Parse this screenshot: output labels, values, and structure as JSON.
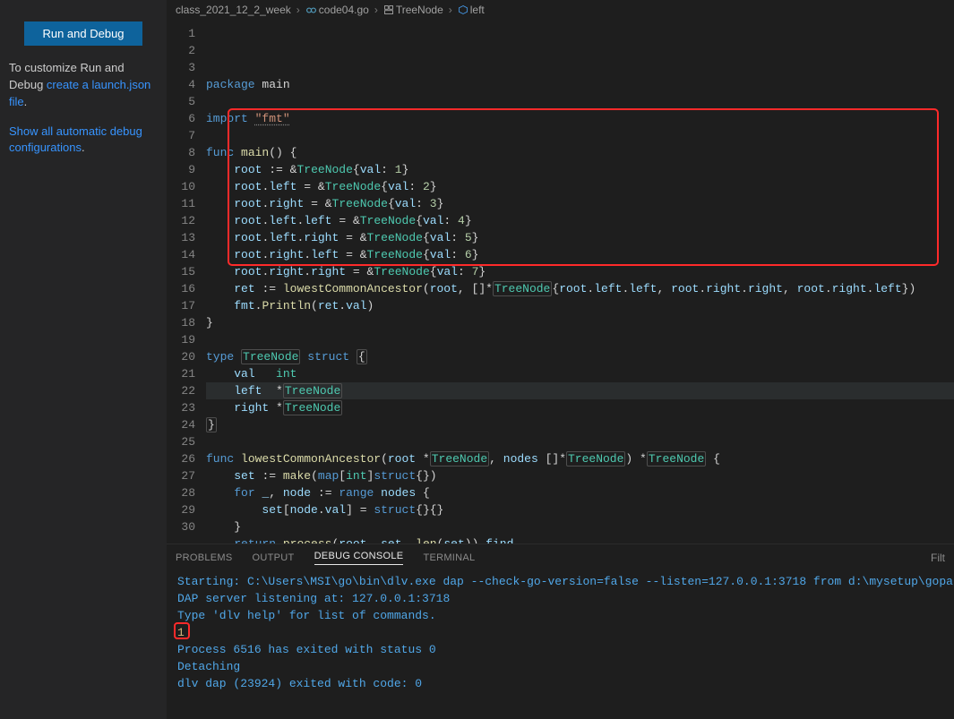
{
  "sidebar": {
    "run_debug_label": "Run and Debug",
    "customize_prefix": "To customize Run and Debug ",
    "customize_link1": "create a launch.json file",
    "customize_suffix": ".",
    "link2_prefix": "Show all automatic debug configurations",
    "link2_suffix": "."
  },
  "breadcrumbs": {
    "seg0": "class_2021_12_2_week",
    "seg1": "code04.go",
    "seg2": "TreeNode",
    "seg3": "left"
  },
  "code_lines": [
    {
      "n": 1,
      "t": "<span class='kw'>package</span> <span class='pln'>main</span>"
    },
    {
      "n": 2,
      "t": ""
    },
    {
      "n": 3,
      "t": "<span class='kw'>import</span> <span class='imp'>\"fmt\"</span>"
    },
    {
      "n": 4,
      "t": ""
    },
    {
      "n": 5,
      "t": "<span class='kw'>func</span> <span class='fn'>main</span><span class='pln'>() </span><span class='op'>{</span>"
    },
    {
      "n": 6,
      "t": "    <span class='id'>root</span> <span class='op'>:=</span> <span class='op'>&amp;</span><span class='ty'>TreeNode</span><span class='op'>{</span><span class='id'>val</span><span class='op'>:</span> <span class='num'>1</span><span class='op'>}</span>"
    },
    {
      "n": 7,
      "t": "    <span class='id'>root</span><span class='op'>.</span><span class='id'>left</span> <span class='op'>=</span> <span class='op'>&amp;</span><span class='ty'>TreeNode</span><span class='op'>{</span><span class='id'>val</span><span class='op'>:</span> <span class='num'>2</span><span class='op'>}</span>"
    },
    {
      "n": 8,
      "t": "    <span class='id'>root</span><span class='op'>.</span><span class='id'>right</span> <span class='op'>=</span> <span class='op'>&amp;</span><span class='ty'>TreeNode</span><span class='op'>{</span><span class='id'>val</span><span class='op'>:</span> <span class='num'>3</span><span class='op'>}</span>"
    },
    {
      "n": 9,
      "t": "    <span class='id'>root</span><span class='op'>.</span><span class='id'>left</span><span class='op'>.</span><span class='id'>left</span> <span class='op'>=</span> <span class='op'>&amp;</span><span class='ty'>TreeNode</span><span class='op'>{</span><span class='id'>val</span><span class='op'>:</span> <span class='num'>4</span><span class='op'>}</span>"
    },
    {
      "n": 10,
      "t": "    <span class='id'>root</span><span class='op'>.</span><span class='id'>left</span><span class='op'>.</span><span class='id'>right</span> <span class='op'>=</span> <span class='op'>&amp;</span><span class='ty'>TreeNode</span><span class='op'>{</span><span class='id'>val</span><span class='op'>:</span> <span class='num'>5</span><span class='op'>}</span>"
    },
    {
      "n": 11,
      "t": "    <span class='id'>root</span><span class='op'>.</span><span class='id'>right</span><span class='op'>.</span><span class='id'>left</span> <span class='op'>=</span> <span class='op'>&amp;</span><span class='ty'>TreeNode</span><span class='op'>{</span><span class='id'>val</span><span class='op'>:</span> <span class='num'>6</span><span class='op'>}</span>"
    },
    {
      "n": 12,
      "t": "    <span class='id'>root</span><span class='op'>.</span><span class='id'>right</span><span class='op'>.</span><span class='id'>right</span> <span class='op'>=</span> <span class='op'>&amp;</span><span class='ty'>TreeNode</span><span class='op'>{</span><span class='id'>val</span><span class='op'>:</span> <span class='num'>7</span><span class='op'>}</span>"
    },
    {
      "n": 13,
      "t": "    <span class='id'>ret</span> <span class='op'>:=</span> <span class='fn'>lowestCommonAncestor</span><span class='op'>(</span><span class='id'>root</span><span class='op'>,</span> <span class='op'>[]*</span><span class='ty boxed'>TreeNode</span><span class='op'>{</span><span class='id'>root</span><span class='op'>.</span><span class='id'>left</span><span class='op'>.</span><span class='id'>left</span><span class='op'>,</span> <span class='id'>root</span><span class='op'>.</span><span class='id'>right</span><span class='op'>.</span><span class='id'>right</span><span class='op'>,</span> <span class='id'>root</span><span class='op'>.</span><span class='id'>right</span><span class='op'>.</span><span class='id'>left</span><span class='op'>})</span>"
    },
    {
      "n": 14,
      "t": "    <span class='id'>fmt</span><span class='op'>.</span><span class='fn'>Println</span><span class='op'>(</span><span class='id'>ret</span><span class='op'>.</span><span class='id'>val</span><span class='op'>)</span>"
    },
    {
      "n": 15,
      "t": "<span class='op'>}</span>"
    },
    {
      "n": 16,
      "t": ""
    },
    {
      "n": 17,
      "t": "<span class='kw'>type</span> <span class='ty boxed'>TreeNode</span> <span class='kw'>struct</span> <span class='op boxed'>{</span>"
    },
    {
      "n": 18,
      "t": "    <span class='id'>val</span>   <span class='ty'>int</span>"
    },
    {
      "n": 19,
      "t": "    <span class='id'>left</span>  <span class='op'>*</span><span class='ty boxed'>TreeNode</span>",
      "hl": true
    },
    {
      "n": 20,
      "t": "    <span class='id'>right</span> <span class='op'>*</span><span class='ty boxed'>TreeNode</span>"
    },
    {
      "n": 21,
      "t": "<span class='op boxed'>}</span>"
    },
    {
      "n": 22,
      "t": ""
    },
    {
      "n": 23,
      "t": "<span class='kw'>func</span> <span class='fn'>lowestCommonAncestor</span><span class='op'>(</span><span class='id'>root</span> <span class='op'>*</span><span class='ty boxed'>TreeNode</span><span class='op'>,</span> <span class='id'>nodes</span> <span class='op'>[]*</span><span class='ty boxed'>TreeNode</span><span class='op'>)</span> <span class='op'>*</span><span class='ty boxed'>TreeNode</span> <span class='op'>{</span>"
    },
    {
      "n": 24,
      "t": "    <span class='id'>set</span> <span class='op'>:=</span> <span class='fn'>make</span><span class='op'>(</span><span class='kw'>map</span><span class='op'>[</span><span class='ty'>int</span><span class='op'>]</span><span class='kw'>struct</span><span class='op'>{})</span>"
    },
    {
      "n": 25,
      "t": "    <span class='kw'>for</span> <span class='id'>_</span><span class='op'>,</span> <span class='id'>node</span> <span class='op'>:=</span> <span class='kw'>range</span> <span class='id'>nodes</span> <span class='op'>{</span>"
    },
    {
      "n": 26,
      "t": "        <span class='id'>set</span><span class='op'>[</span><span class='id'>node</span><span class='op'>.</span><span class='id'>val</span><span class='op'>]</span> <span class='op'>=</span> <span class='kw'>struct</span><span class='op'>{}{}</span>"
    },
    {
      "n": 27,
      "t": "    <span class='op'>}</span>"
    },
    {
      "n": 28,
      "t": "    <span class='kw'>return</span> <span class='fn'>process</span><span class='op'>(</span><span class='id'>root</span><span class='op'>,</span> <span class='id'>set</span><span class='op'>,</span> <span class='fn'>len</span><span class='op'>(</span><span class='id'>set</span><span class='op'>)).</span><span class='id'>find</span>"
    },
    {
      "n": 29,
      "t": "<span class='op'>}</span>"
    },
    {
      "n": 30,
      "t": ""
    }
  ],
  "panel": {
    "tabs": {
      "problems": "PROBLEMS",
      "output": "OUTPUT",
      "debug_console": "DEBUG CONSOLE",
      "terminal": "TERMINAL"
    },
    "filter_placeholder": "Filt",
    "console_lines": [
      {
        "c": "info",
        "t": "Starting: C:\\Users\\MSI\\go\\bin\\dlv.exe dap --check-go-version=false --listen=127.0.0.1:3718 from d:\\mysetup\\gopath"
      },
      {
        "c": "info",
        "t": "DAP server listening at: 127.0.0.1:3718"
      },
      {
        "c": "info",
        "t": "Type 'dlv help' for list of commands."
      },
      {
        "c": "result",
        "t": "1"
      },
      {
        "c": "info",
        "t": "Process 6516 has exited with status 0"
      },
      {
        "c": "info",
        "t": "Detaching"
      },
      {
        "c": "info",
        "t": "dlv dap (23924) exited with code: 0"
      }
    ]
  }
}
